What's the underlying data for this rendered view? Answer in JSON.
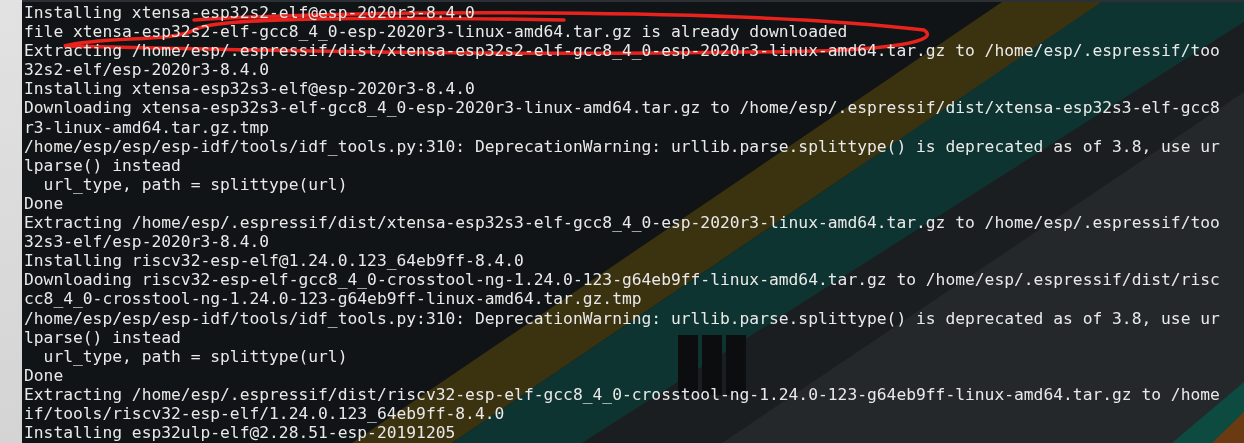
{
  "terminal": {
    "lines": [
      {
        "text": "Installing xtensa-esp32s2-elf@esp-2020r3-8.4.0",
        "circled": false
      },
      {
        "text": "file xtensa-esp32s2-elf-gcc8_4_0-esp-2020r3-linux-amd64.tar.gz is already downloaded",
        "circled": true
      },
      {
        "text": "Extracting /home/esp/.espressif/dist/xtensa-esp32s2-elf-gcc8_4_0-esp-2020r3-linux-amd64.tar.gz to /home/esp/.espressif/too",
        "circled": false
      },
      {
        "text": "32s2-elf/esp-2020r3-8.4.0",
        "circled": false
      },
      {
        "text": "Installing xtensa-esp32s3-elf@esp-2020r3-8.4.0",
        "circled": false
      },
      {
        "text": "Downloading xtensa-esp32s3-elf-gcc8_4_0-esp-2020r3-linux-amd64.tar.gz to /home/esp/.espressif/dist/xtensa-esp32s3-elf-gcc8",
        "circled": false
      },
      {
        "text": "r3-linux-amd64.tar.gz.tmp",
        "circled": false
      },
      {
        "text": "/home/esp/esp/esp-idf/tools/idf_tools.py:310: DeprecationWarning: urllib.parse.splittype() is deprecated as of 3.8, use ur",
        "circled": false
      },
      {
        "text": "lparse() instead",
        "circled": false
      },
      {
        "text": "  url_type, path = splittype(url)",
        "circled": false
      },
      {
        "text": "Done",
        "circled": false
      },
      {
        "text": "Extracting /home/esp/.espressif/dist/xtensa-esp32s3-elf-gcc8_4_0-esp-2020r3-linux-amd64.tar.gz to /home/esp/.espressif/too",
        "circled": false
      },
      {
        "text": "32s3-elf/esp-2020r3-8.4.0",
        "circled": false
      },
      {
        "text": "Installing riscv32-esp-elf@1.24.0.123_64eb9ff-8.4.0",
        "circled": false
      },
      {
        "text": "Downloading riscv32-esp-elf-gcc8_4_0-crosstool-ng-1.24.0-123-g64eb9ff-linux-amd64.tar.gz to /home/esp/.espressif/dist/risc",
        "circled": false
      },
      {
        "text": "cc8_4_0-crosstool-ng-1.24.0-123-g64eb9ff-linux-amd64.tar.gz.tmp",
        "circled": false
      },
      {
        "text": "/home/esp/esp/esp-idf/tools/idf_tools.py:310: DeprecationWarning: urllib.parse.splittype() is deprecated as of 3.8, use ur",
        "circled": false
      },
      {
        "text": "lparse() instead",
        "circled": false
      },
      {
        "text": "  url_type, path = splittype(url)",
        "circled": false
      },
      {
        "text": "Done",
        "circled": false
      },
      {
        "text": "Extracting /home/esp/.espressif/dist/riscv32-esp-elf-gcc8_4_0-crosstool-ng-1.24.0-123-g64eb9ff-linux-amd64.tar.gz to /home",
        "circled": false
      },
      {
        "text": "if/tools/riscv32-esp-elf/1.24.0.123_64eb9ff-8.4.0",
        "circled": false
      },
      {
        "text": "Installing esp32ulp-elf@2.28.51-esp-20191205",
        "circled": false
      }
    ]
  }
}
